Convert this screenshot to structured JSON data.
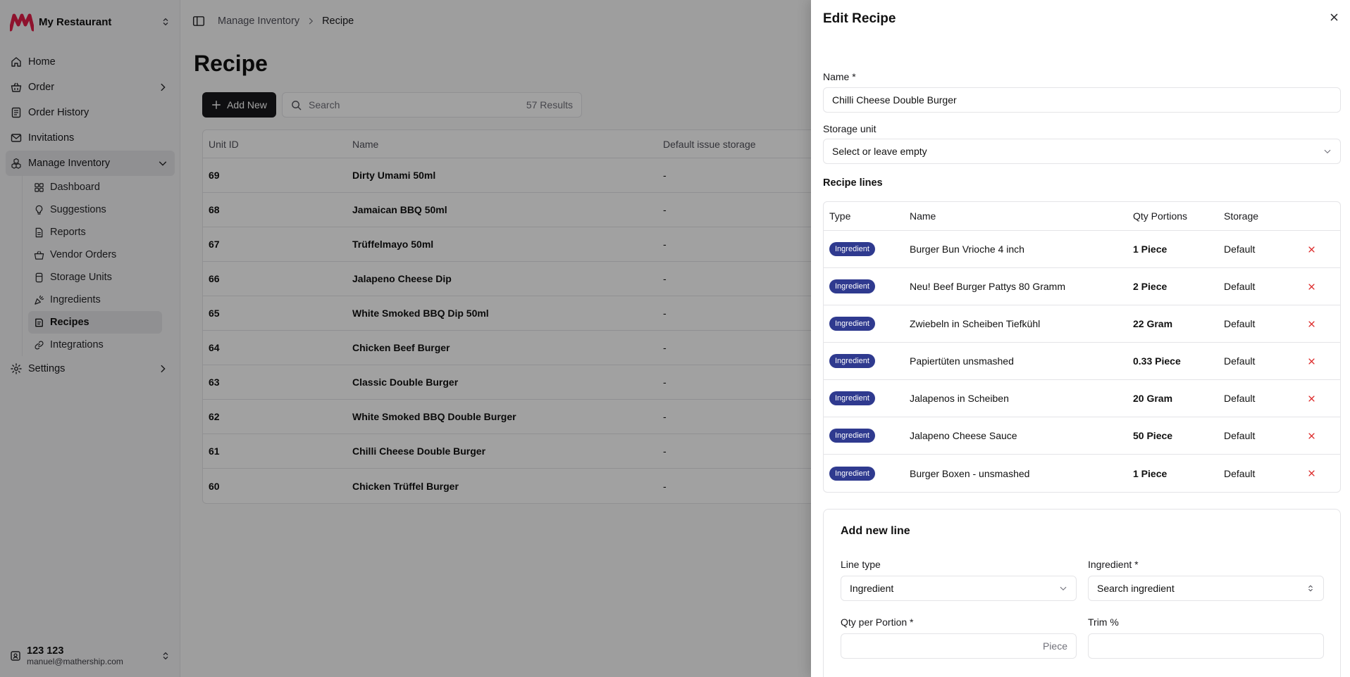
{
  "app": {
    "name": "My Restaurant"
  },
  "sidebar": {
    "items": [
      {
        "label": "Home"
      },
      {
        "label": "Order"
      },
      {
        "label": "Order History"
      },
      {
        "label": "Invitations"
      },
      {
        "label": "Manage Inventory"
      },
      {
        "label": "Settings"
      }
    ],
    "inventory_items": [
      {
        "label": "Dashboard"
      },
      {
        "label": "Suggestions"
      },
      {
        "label": "Reports"
      },
      {
        "label": "Vendor Orders"
      },
      {
        "label": "Storage Units"
      },
      {
        "label": "Ingredients"
      },
      {
        "label": "Recipes"
      },
      {
        "label": "Integrations"
      }
    ]
  },
  "user": {
    "name": "123 123",
    "email": "manuel@mathership.com"
  },
  "breadcrumb": {
    "parent": "Manage Inventory",
    "current": "Recipe"
  },
  "page": {
    "title": "Recipe",
    "add_label": "Add New",
    "search_placeholder": "Search",
    "results": "57 Results"
  },
  "table": {
    "headers": [
      "Unit ID",
      "Name",
      "Default issue storage"
    ],
    "rows": [
      {
        "id": "69",
        "name": "Dirty Umami 50ml",
        "storage": "-"
      },
      {
        "id": "68",
        "name": "Jamaican BBQ 50ml",
        "storage": "-"
      },
      {
        "id": "67",
        "name": "Trüffelmayo 50ml",
        "storage": "-"
      },
      {
        "id": "66",
        "name": "Jalapeno Cheese Dip",
        "storage": "-"
      },
      {
        "id": "65",
        "name": "White Smoked BBQ Dip 50ml",
        "storage": "-"
      },
      {
        "id": "64",
        "name": "Chicken Beef Burger",
        "storage": "-"
      },
      {
        "id": "63",
        "name": "Classic Double Burger",
        "storage": "-"
      },
      {
        "id": "62",
        "name": "White Smoked BBQ Double Burger",
        "storage": "-"
      },
      {
        "id": "61",
        "name": "Chilli Cheese Double Burger",
        "storage": "-"
      },
      {
        "id": "60",
        "name": "Chicken Trüffel Burger",
        "storage": "-"
      }
    ]
  },
  "drawer": {
    "title": "Edit Recipe",
    "name_label": "Name *",
    "name_value": "Chilli Cheese Double Burger",
    "storage_label": "Storage unit",
    "storage_placeholder": "Select or leave empty",
    "lines_title": "Recipe lines",
    "lines_headers": [
      "Type",
      "Name",
      "Qty Portions",
      "Storage"
    ],
    "lines": [
      {
        "type": "Ingredient",
        "name": "Burger Bun Vrioche 4 inch",
        "qty": "1 Piece",
        "storage": "Default"
      },
      {
        "type": "Ingredient",
        "name": "Neu! Beef Burger Pattys 80 Gramm",
        "qty": "2 Piece",
        "storage": "Default"
      },
      {
        "type": "Ingredient",
        "name": "Zwiebeln in Scheiben Tiefkühl",
        "qty": "22 Gram",
        "storage": "Default"
      },
      {
        "type": "Ingredient",
        "name": "Papiertüten unsmashed",
        "qty": "0.33 Piece",
        "storage": "Default"
      },
      {
        "type": "Ingredient",
        "name": "Jalapenos in Scheiben",
        "qty": "20 Gram",
        "storage": "Default"
      },
      {
        "type": "Ingredient",
        "name": "Jalapeno Cheese Sauce",
        "qty": "50 Piece",
        "storage": "Default"
      },
      {
        "type": "Ingredient",
        "name": "Burger Boxen - unsmashed",
        "qty": "1 Piece",
        "storage": "Default"
      }
    ],
    "add_line": {
      "title": "Add new line",
      "line_type_label": "Line type",
      "line_type_value": "Ingredient",
      "ingredient_label": "Ingredient *",
      "ingredient_placeholder": "Search ingredient",
      "qty_label": "Qty per Portion *",
      "qty_unit": "Piece",
      "trim_label": "Trim %"
    }
  },
  "colors": {
    "badge": "#2f3a8f",
    "delete": "#dc2626",
    "brand": "#e11d48"
  }
}
